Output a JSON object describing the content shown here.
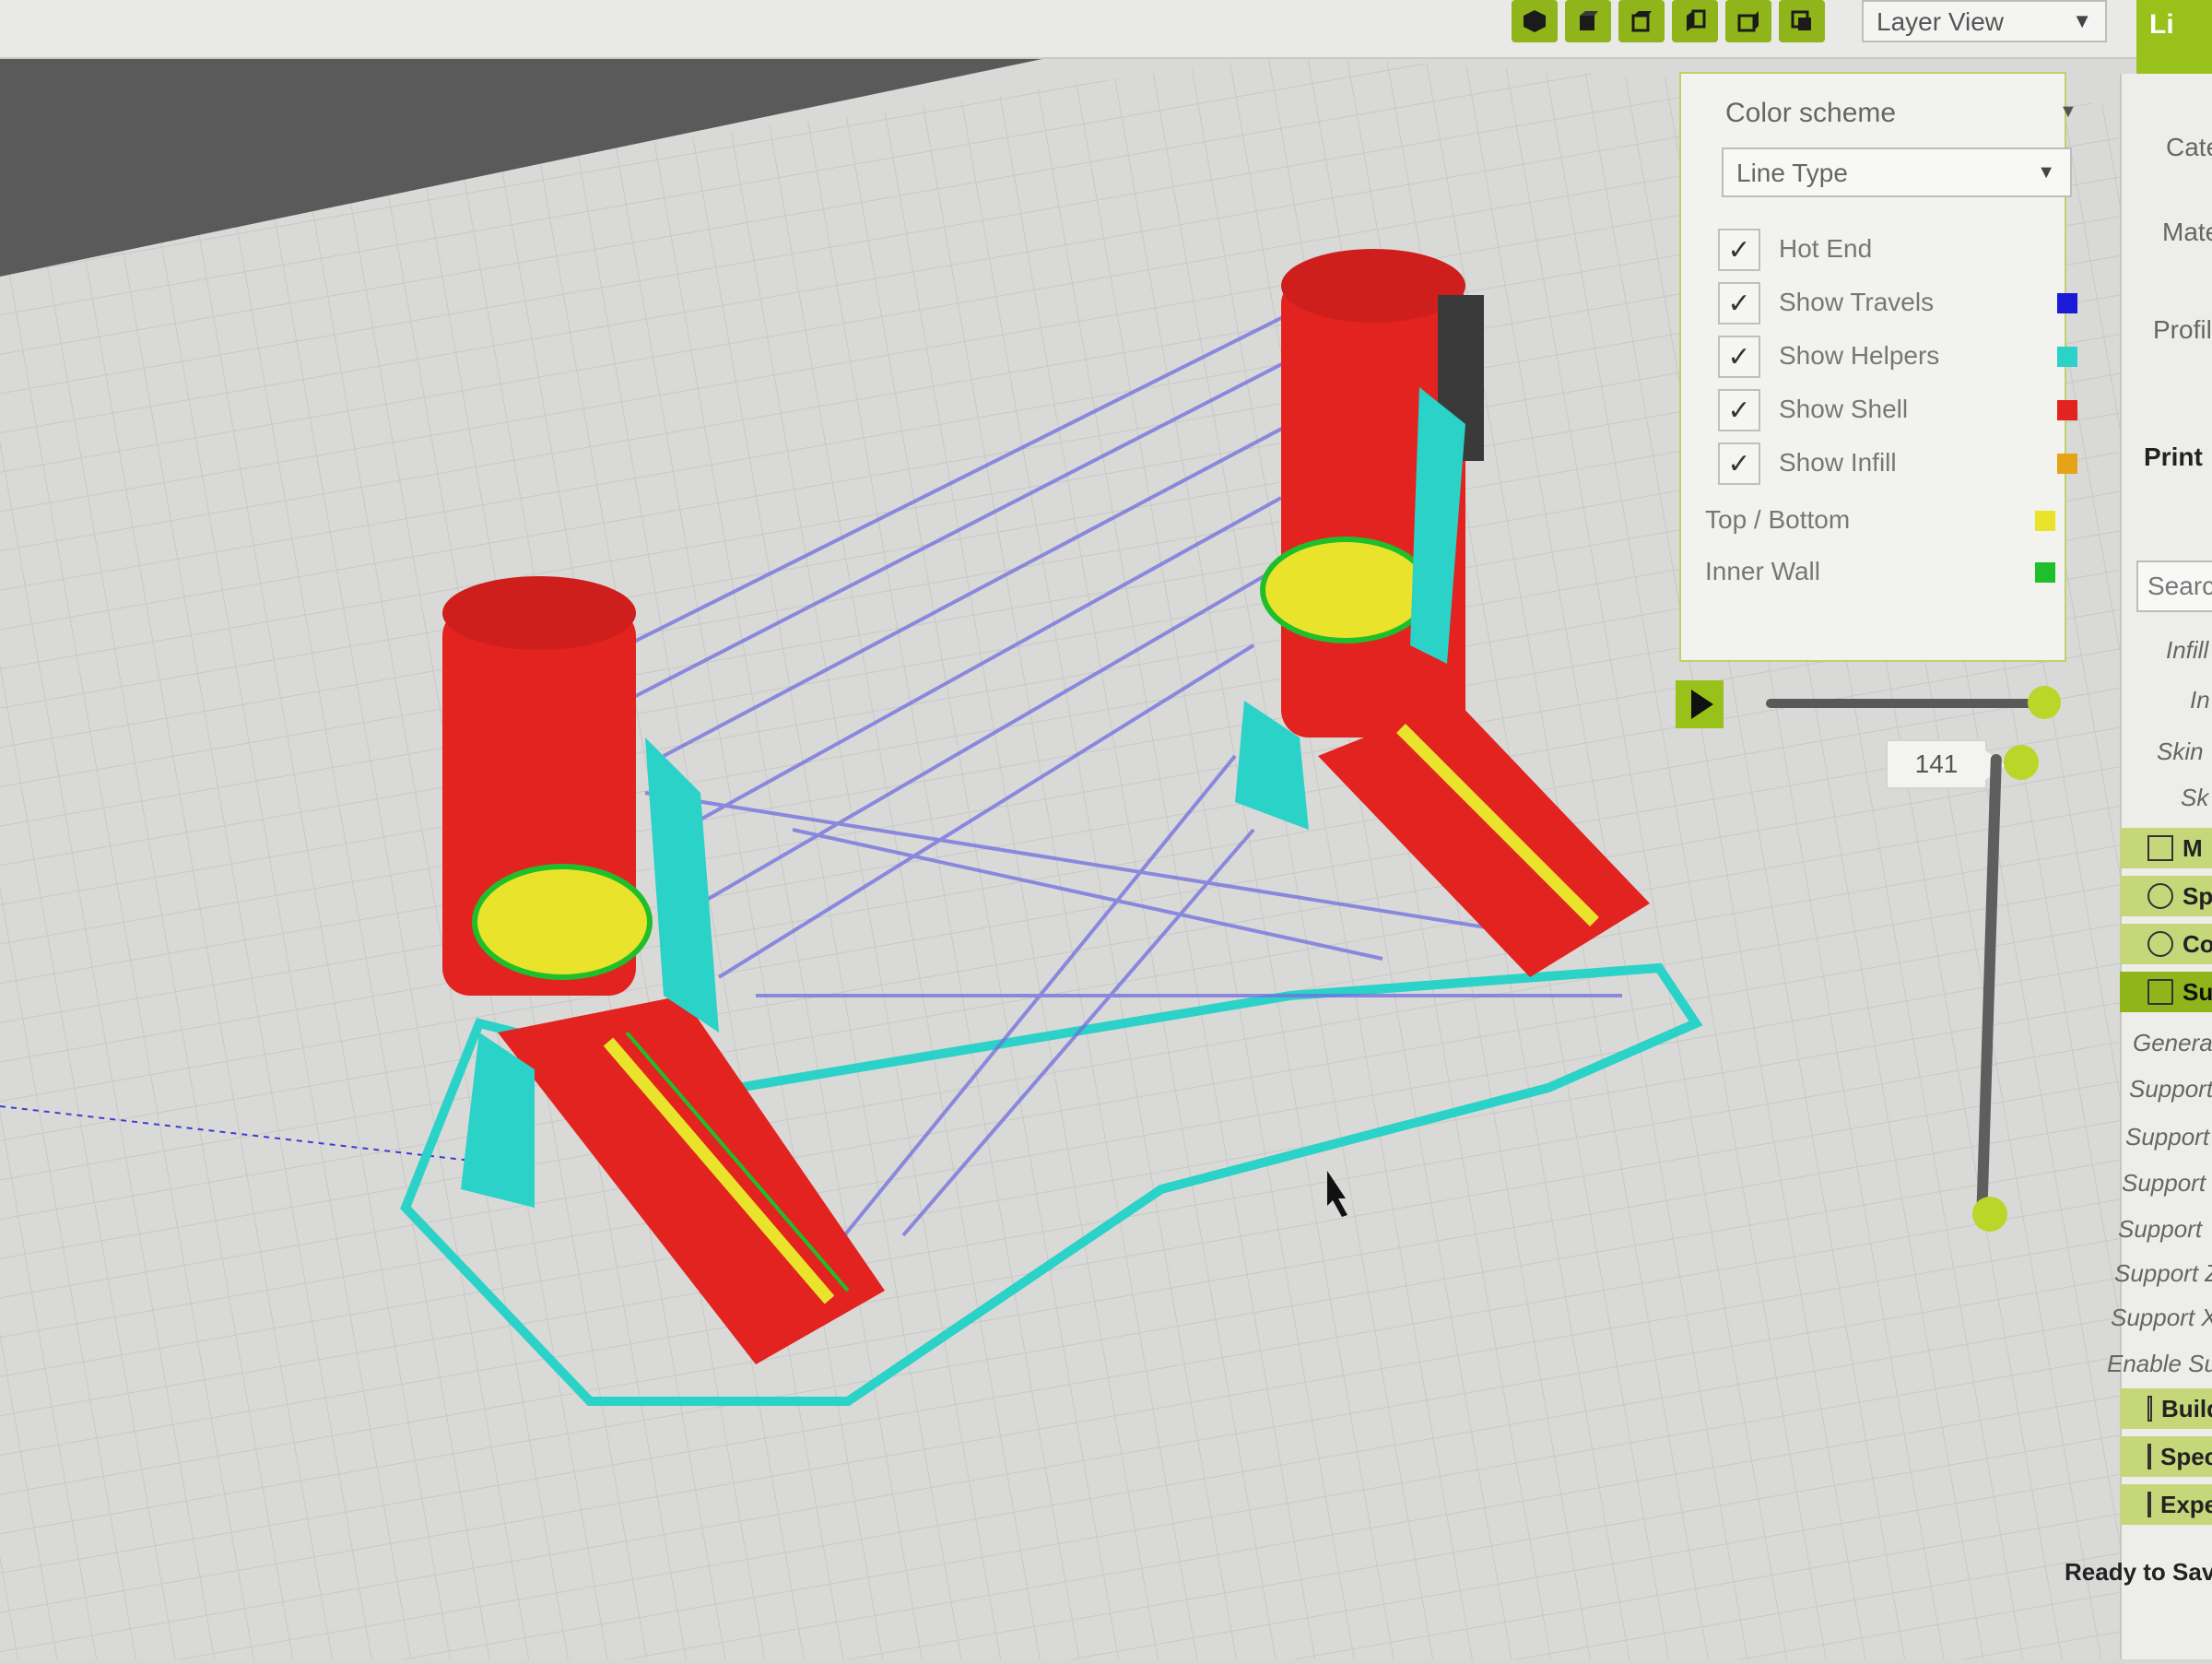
{
  "toolbar": {
    "view_buttons": [
      "view-3d-icon",
      "view-front-icon",
      "view-top-icon",
      "view-left-icon",
      "view-right-icon",
      "view-layers-icon"
    ],
    "view_mode": "Layer View",
    "accent_tab": "Li"
  },
  "layer_panel": {
    "color_scheme_label": "Color scheme",
    "line_type_value": "Line Type",
    "options": [
      {
        "label": "Hot End",
        "checked": true
      },
      {
        "label": "Show Travels",
        "checked": true,
        "color": "#1a1ad8"
      },
      {
        "label": "Show Helpers",
        "checked": true,
        "color": "#2ad2c8"
      },
      {
        "label": "Show Shell",
        "checked": true,
        "color": "#e3231f"
      },
      {
        "label": "Show Infill",
        "checked": true,
        "color": "#e6a317"
      }
    ],
    "legend": [
      {
        "label": "Top / Bottom",
        "color": "#e9e32c"
      },
      {
        "label": "Inner Wall",
        "color": "#1fbf2c"
      }
    ],
    "current_layer": "141",
    "play_progress": 1.0
  },
  "right_panel": {
    "labels": [
      "Cate",
      "Mate",
      "Profil",
      "Print"
    ],
    "search_placeholder": "Search",
    "settings_items": [
      "Infill",
      "In",
      "Skin",
      "Sk"
    ],
    "categories": [
      {
        "label": "M",
        "icon": "barcode-icon"
      },
      {
        "label": "Sp",
        "icon": "speed-icon"
      },
      {
        "label": "Co",
        "icon": "fan-icon"
      },
      {
        "label": "Su",
        "icon": "support-icon",
        "active": true
      }
    ],
    "support_items": [
      "General",
      "Support",
      "Support",
      "Support",
      "Support",
      "Support Z",
      "Support X",
      "Enable Su"
    ],
    "bottom_categories": [
      {
        "label": "Build",
        "icon": "build-plate-icon"
      },
      {
        "label": "Specia",
        "icon": "special-modes-icon"
      },
      {
        "label": "Experi",
        "icon": "experimental-icon"
      }
    ],
    "status": "Ready to Save"
  }
}
